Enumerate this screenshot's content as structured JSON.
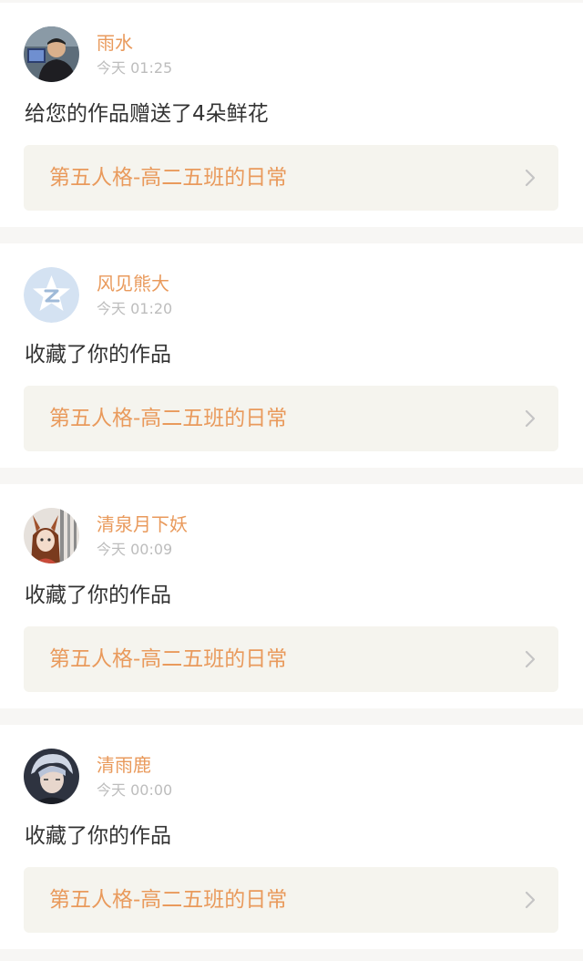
{
  "notifications": [
    {
      "username": "雨水",
      "time": "今天 01:25",
      "action": "给您的作品赠送了4朵鲜花",
      "work_title": "第五人格-高二五班的日常"
    },
    {
      "username": "风见熊大",
      "time": "今天 01:20",
      "action": "收藏了你的作品",
      "work_title": "第五人格-高二五班的日常"
    },
    {
      "username": "清泉月下妖",
      "time": "今天 00:09",
      "action": "收藏了你的作品",
      "work_title": "第五人格-高二五班的日常"
    },
    {
      "username": "清雨鹿",
      "time": "今天 00:00",
      "action": "收藏了你的作品",
      "work_title": "第五人格-高二五班的日常"
    }
  ],
  "colors": {
    "accent": "#e99a5c",
    "text": "#333333",
    "muted": "#bdbdbd",
    "link_bg": "#f5f4ee",
    "page_bg": "#f7f6f4"
  },
  "icons": {
    "chevron": "chevron-right-icon",
    "default_avatar": "default-avatar-icon"
  }
}
